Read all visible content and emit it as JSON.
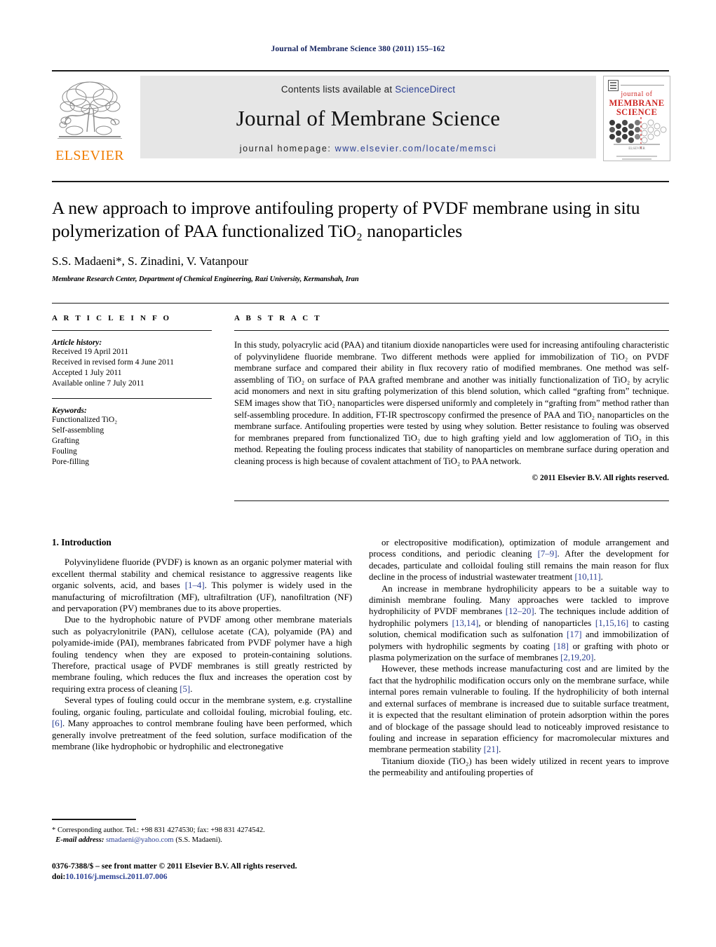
{
  "running_head": "Journal of Membrane Science 380 (2011) 155–162",
  "masthead": {
    "contents_prefix": "Contents lists available at ",
    "sciencedirect": "ScienceDirect",
    "journal_title": "Journal of Membrane Science",
    "homepage_prefix": "journal homepage: ",
    "homepage_url": "www.elsevier.com/locate/memsci",
    "publisher": "ELSEVIER",
    "cover": {
      "line1": "journal of",
      "line2": "MEMBRANE",
      "line3": "SCIENCE",
      "imprint": "ELSEVIER"
    },
    "accent_blue": "#2b3f93",
    "accent_orange": "#f07c00",
    "cover_red": "#cf2a27"
  },
  "article": {
    "title": "A new approach to improve antifouling property of PVDF membrane using in situ polymerization of PAA functionalized TiO₂ nanoparticles",
    "authors": "S.S. Madaeni*, S. Zinadini, V. Vatanpour",
    "affiliation": "Membrane Research Center, Department of Chemical Engineering, Razi University, Kermanshah, Iran"
  },
  "info": {
    "heading": "A R T I C L E  I N F O",
    "history_label": "Article history:",
    "history": [
      "Received 19 April 2011",
      "Received in revised form 4 June 2011",
      "Accepted 1 July 2011",
      "Available online 7 July 2011"
    ],
    "keywords_label": "Keywords:",
    "keywords": [
      "Functionalized TiO₂",
      "Self-assembling",
      "Grafting",
      "Fouling",
      "Pore-filling"
    ]
  },
  "abstract": {
    "heading": "A B S T R A C T",
    "text": "In this study, polyacrylic acid (PAA) and titanium dioxide nanoparticles were used for increasing antifouling characteristic of polyvinylidene fluoride membrane. Two different methods were applied for immobilization of TiO₂ on PVDF membrane surface and compared their ability in flux recovery ratio of modified membranes. One method was self-assembling of TiO₂ on surface of PAA grafted membrane and another was initially functionalization of TiO₂ by acrylic acid monomers and next in situ grafting polymerization of this blend solution, which called “grafting from” technique. SEM images show that TiO₂ nanoparticles were dispersed uniformly and completely in “grafting from” method rather than self-assembling procedure. In addition, FT-IR spectroscopy confirmed the presence of PAA and TiO₂ nanoparticles on the membrane surface. Antifouling properties were tested by using whey solution. Better resistance to fouling was observed for membranes prepared from functionalized TiO₂ due to high grafting yield and low agglomeration of TiO₂ in this method. Repeating the fouling process indicates that stability of nanoparticles on membrane surface during operation and cleaning process is high because of covalent attachment of TiO₂ to PAA network.",
    "copyright": "© 2011 Elsevier B.V. All rights reserved."
  },
  "body": {
    "section_heading": "1.  Introduction",
    "left_paragraphs": [
      "Polyvinylidene fluoride (PVDF) is known as an organic polymer material with excellent thermal stability and chemical resistance to aggressive reagents like organic solvents, acid, and bases [1–4]. This polymer is widely used in the manufacturing of microfiltration (MF), ultrafiltration (UF), nanofiltration (NF) and pervaporation (PV) membranes due to its above properties.",
      "Due to the hydrophobic nature of PVDF among other membrane materials such as polyacrylonitrile (PAN), cellulose acetate (CA), polyamide (PA) and polyamide-imide (PAI), membranes fabricated from PVDF polymer have a high fouling tendency when they are exposed to protein-containing solutions. Therefore, practical usage of PVDF membranes is still greatly restricted by membrane fouling, which reduces the flux and increases the operation cost by requiring extra process of cleaning [5].",
      "Several types of fouling could occur in the membrane system, e.g. crystalline fouling, organic fouling, particulate and colloidal fouling, microbial fouling, etc. [6]. Many approaches to control membrane fouling have been performed, which generally involve pretreatment of the feed solution, surface modification of the membrane (like hydrophobic or hydrophilic and electronegative"
    ],
    "right_paragraphs": [
      "or electropositive modification), optimization of module arrangement and process conditions, and periodic cleaning [7–9]. After the development for decades, particulate and colloidal fouling still remains the main reason for flux decline in the process of industrial wastewater treatment [10,11].",
      "An increase in membrane hydrophilicity appears to be a suitable way to diminish membrane fouling. Many approaches were tackled to improve hydrophilicity of PVDF membranes [12–20]. The techniques include addition of hydrophilic polymers [13,14], or blending of nanoparticles [1,15,16] to casting solution, chemical modification such as sulfonation [17] and immobilization of polymers with hydrophilic segments by coating [18] or grafting with photo or plasma polymerization on the surface of membranes [2,19,20].",
      "However, these methods increase manufacturing cost and are limited by the fact that the hydrophilic modification occurs only on the membrane surface, while internal pores remain vulnerable to fouling. If the hydrophilicity of both internal and external surfaces of membrane is increased due to suitable surface treatment, it is expected that the resultant elimination of protein adsorption within the pores and of blockage of the passage should lead to noticeably improved resistance to fouling and increase in separation efficiency for macromolecular mixtures and membrane permeation stability [21].",
      "Titanium dioxide (TiO₂) has been widely utilized in recent years to improve the permeability and antifouling properties of"
    ]
  },
  "footnote": {
    "corresponding": "* Corresponding author. Tel.: +98 831 4274530; fax: +98 831 4274542.",
    "email_label": "E-mail address:",
    "email": "smadaeni@yahoo.com",
    "email_owner": "(S.S. Madaeni)."
  },
  "page_footer": {
    "front_matter": "0376-7388/$ – see front matter © 2011 Elsevier B.V. All rights reserved.",
    "doi_label": "doi:",
    "doi": "10.1016/j.memsci.2011.07.006"
  }
}
